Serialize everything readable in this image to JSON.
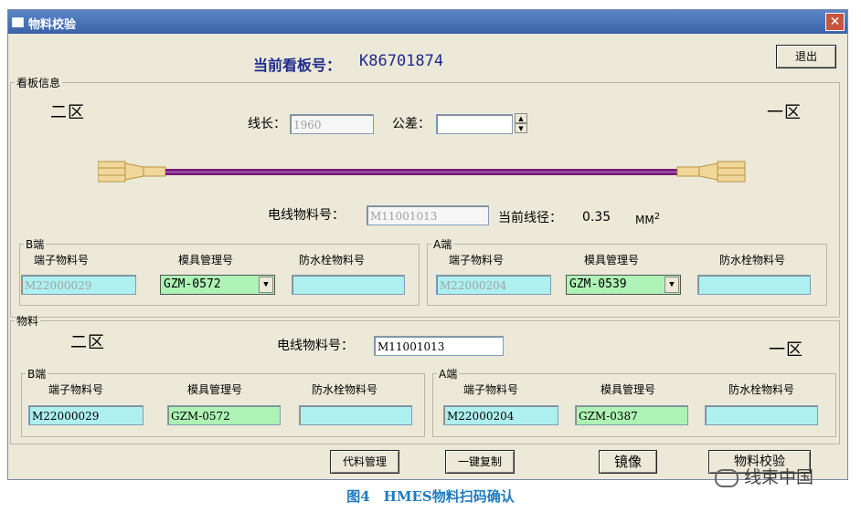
{
  "window": {
    "title": "物料校验",
    "close_glyph": "✕"
  },
  "header": {
    "board_no_label": "当前看板号：",
    "board_no": "K86701874",
    "exit_button": "退出"
  },
  "kanban": {
    "legend": "看板信息",
    "zone_left": "二区",
    "zone_right": "一区",
    "line_length_label": "线长：",
    "line_length_value": "1960",
    "tolerance_label": "公差：",
    "tolerance_value": "",
    "wire_no_label": "电线物料号：",
    "wire_no_value": "M11001013",
    "diameter_label": "当前线径：",
    "diameter_value": "0.35",
    "diameter_unit": "MM",
    "diameter_sup": "2",
    "b_end": {
      "legend": "B端",
      "col_terminal": "端子物料号",
      "col_mold": "模具管理号",
      "col_seal": "防水栓物料号",
      "terminal": "M22000029",
      "mold": "GZM-0572",
      "seal": ""
    },
    "a_end": {
      "legend": "A端",
      "col_terminal": "端子物料号",
      "col_mold": "模具管理号",
      "col_seal": "防水栓物料号",
      "terminal": "M22000204",
      "mold": "GZM-0539",
      "seal": ""
    }
  },
  "material": {
    "legend": "物料",
    "zone_left": "二区",
    "zone_right": "一区",
    "wire_no_label": "电线物料号：",
    "wire_no_value": "M11001013",
    "b_end": {
      "legend": "B端",
      "col_terminal": "端子物料号",
      "col_mold": "模具管理号",
      "col_seal": "防水栓物料号",
      "terminal": "M22000029",
      "mold": "GZM-0572",
      "seal": ""
    },
    "a_end": {
      "legend": "A端",
      "col_terminal": "端子物料号",
      "col_mold": "模具管理号",
      "col_seal": "防水栓物料号",
      "terminal": "M22000204",
      "mold": "GZM-0387",
      "seal": ""
    }
  },
  "footer_buttons": {
    "substitute": "代料管理",
    "copy": "一键复制",
    "mirror": "镜像",
    "verify": "物料校验"
  },
  "caption": "图4　HMES物料扫码确认",
  "watermark": "线束中国",
  "colors": {
    "title_bar": "#3a63a8",
    "cyan_field": "#aef0f0",
    "green_field": "#aef2b5",
    "wire": "#7b1c7a",
    "accent_text": "#1f2a8c"
  }
}
